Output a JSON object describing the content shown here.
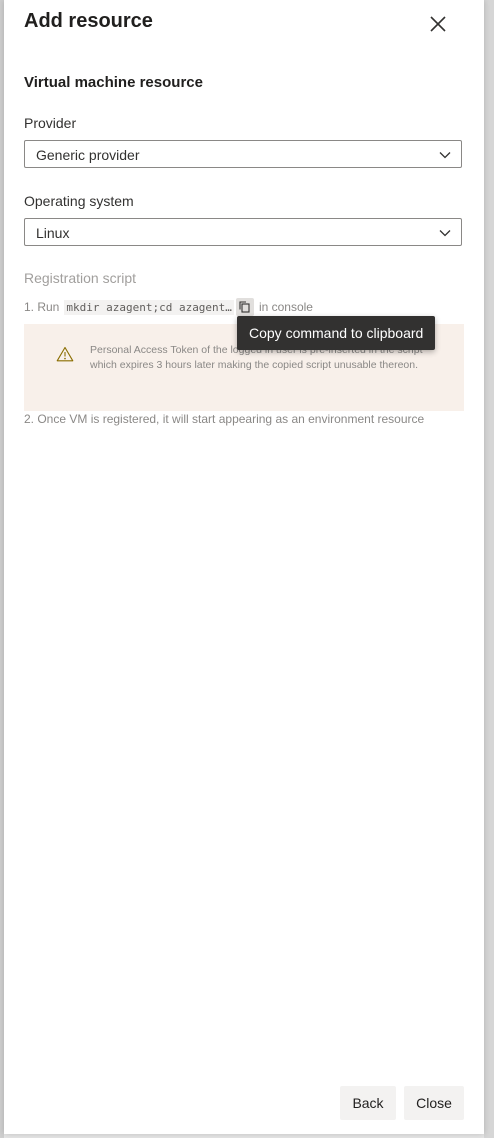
{
  "panel": {
    "title": "Add resource",
    "close_icon": "close-icon"
  },
  "section": {
    "title": "Virtual machine resource"
  },
  "provider": {
    "label": "Provider",
    "value": "Generic provider"
  },
  "os": {
    "label": "Operating system",
    "value": "Linux"
  },
  "registration": {
    "title": "Registration script",
    "step1_prefix": "1. Run",
    "command": "mkdir azagent;cd azagent…",
    "step1_suffix": "in console",
    "warning": "Personal Access Token of the logged in user is pre-inserted in the script which expires 3 hours later making the copied script unusable thereon.",
    "step2": "2. Once VM is registered, it will start appearing as an environment resource"
  },
  "tooltip": {
    "text": "Copy command to clipboard"
  },
  "footer": {
    "back_label": "Back",
    "close_label": "Close"
  },
  "colors": {
    "warning_bg": "#f8f0ea",
    "warning_icon": "#8a6d00",
    "tooltip_bg": "#323130"
  }
}
